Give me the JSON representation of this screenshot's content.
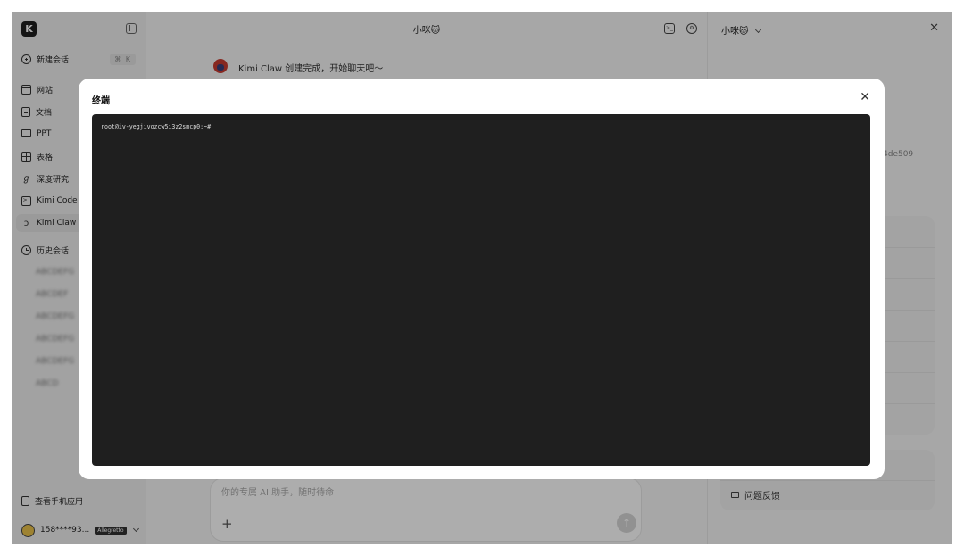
{
  "sidebar": {
    "logo_letter": "K",
    "new_chat": {
      "label": "新建会话",
      "shortcut": "⌘ K"
    },
    "items": [
      {
        "label": "网站",
        "icon": "browser-icon"
      },
      {
        "label": "文档",
        "icon": "document-icon"
      },
      {
        "label": "PPT",
        "icon": "presentation-icon"
      },
      {
        "label": "表格",
        "icon": "table-icon"
      },
      {
        "label": "深度研究",
        "icon": "research-icon"
      },
      {
        "label": "Kimi Code",
        "icon": "terminal-icon"
      },
      {
        "label": "Kimi Claw",
        "icon": "claw-icon"
      }
    ],
    "history_label": "历史会话",
    "history": [
      "ABCDEFG",
      "ABCDEF",
      "ABCDEFG",
      "ABCDEFG",
      "ABCDEFG",
      "ABCD"
    ],
    "mobile_app": "查看手机应用",
    "account": {
      "phone": "158****93...",
      "plan": "Allegretto"
    }
  },
  "main": {
    "title": "小咪🐱",
    "bot_message": "Kimi Claw 创建完成，开始聊天吧～",
    "composer_placeholder": "你的专属 AI 助手，随时待命"
  },
  "right_panel": {
    "title": "小咪🐱",
    "hash_fragment": "4de509",
    "feedback": "问题反馈"
  },
  "modal": {
    "title": "终端",
    "terminal_prompt": "root@iv-yegjivozcw5i3z2smcp0:~#"
  }
}
